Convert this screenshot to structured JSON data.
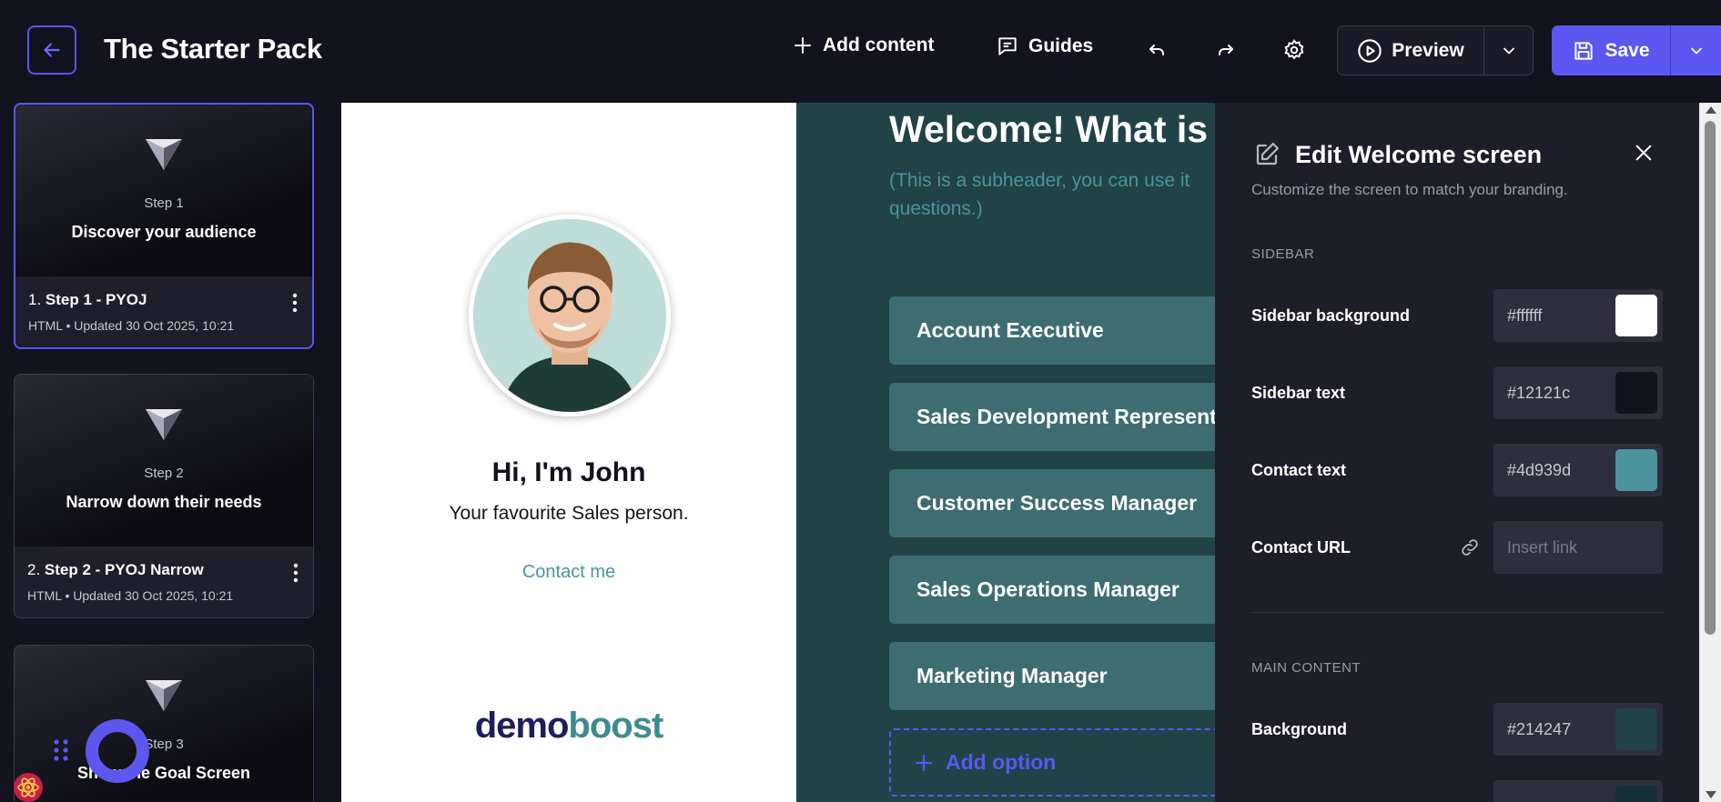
{
  "header": {
    "title": "The Starter Pack",
    "add_content": "Add content",
    "guides": "Guides",
    "preview": "Preview",
    "save": "Save"
  },
  "steps": [
    {
      "thumb_step": "Step 1",
      "thumb_title": "Discover your audience",
      "number": "1.",
      "name": "Step 1 - PYOJ",
      "meta": "HTML • Updated 30 Oct 2025, 10:21"
    },
    {
      "thumb_step": "Step 2",
      "thumb_title": "Narrow down their needs",
      "number": "2.",
      "name": "Step 2 - PYOJ Narrow",
      "meta": "HTML • Updated 30 Oct 2025, 10:21"
    },
    {
      "thumb_step": "Step 3",
      "thumb_title": "Show the Goal Screen"
    }
  ],
  "preview": {
    "sidebar": {
      "name": "Hi, I'm John",
      "role": "Your favourite Sales person.",
      "contact": "Contact me",
      "logo_a": "demo",
      "logo_b": "boost"
    },
    "main": {
      "heading": "Welcome! What is y",
      "subheader": "(This is a subheader, you can use it questions.)",
      "options": [
        "Account Executive",
        "Sales Development Representa",
        "Customer Success Manager",
        "Sales Operations Manager",
        "Marketing Manager"
      ],
      "add_option": "Add option"
    }
  },
  "edit_panel": {
    "title": "Edit Welcome screen",
    "description": "Customize the screen to match your branding.",
    "sidebar_section": "SIDEBAR",
    "main_section": "MAIN CONTENT",
    "fields": {
      "sidebar_background": {
        "label": "Sidebar background",
        "value": "#ffffff"
      },
      "sidebar_text": {
        "label": "Sidebar text",
        "value": "#12121c"
      },
      "contact_text": {
        "label": "Contact text",
        "value": "#4d939d"
      },
      "contact_url": {
        "label": "Contact URL",
        "placeholder": "Insert link"
      },
      "background": {
        "label": "Background",
        "value": "#214247"
      }
    }
  },
  "colors": {
    "accent": "#5b57f0",
    "app_bg": "#13131f",
    "panel_bg": "#1e1e2a",
    "main_content_bg": "#214247",
    "option_bg": "#3d6c72"
  }
}
